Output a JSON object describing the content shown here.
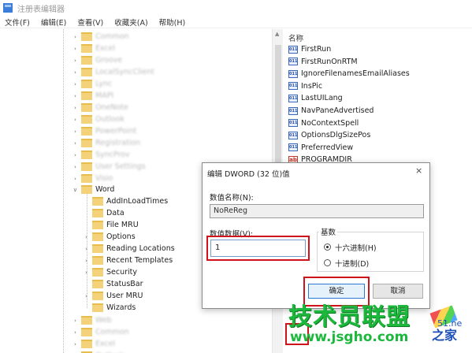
{
  "window": {
    "title": "注册表编辑器"
  },
  "menu": [
    "文件(F)",
    "编辑(E)",
    "查看(V)",
    "收藏夹(A)",
    "帮助(H)"
  ],
  "tree": {
    "blurred_above": [
      "Common",
      "Excel",
      "Groove",
      "LocalSyncClient",
      "Lync",
      "MAPI",
      "OneNote",
      "Outlook",
      "PowerPoint",
      "Registration",
      "SyncProv",
      "User Settings",
      "Visio"
    ],
    "word": {
      "label": "Word",
      "children": [
        "AddInLoadTimes",
        "Data",
        "File MRU",
        "Options",
        "Reading Locations",
        "Recent Templates",
        "Security",
        "StatusBar",
        "User MRU",
        "Wizards"
      ],
      "expandable": [
        "Options",
        "Reading Locations",
        "Recent Templates",
        "Security",
        "User MRU"
      ]
    },
    "blurred_below": [
      "Web",
      "Common",
      "Excel",
      "Outlook"
    ]
  },
  "values_pane": {
    "header": "名称",
    "items": [
      {
        "name": "FirstRun",
        "type": "dword"
      },
      {
        "name": "FirstRunOnRTM",
        "type": "dword"
      },
      {
        "name": "IgnoreFilenamesEmailAliases",
        "type": "dword"
      },
      {
        "name": "InsPic",
        "type": "dword"
      },
      {
        "name": "LastUILang",
        "type": "dword"
      },
      {
        "name": "NavPaneAdvertised",
        "type": "dword"
      },
      {
        "name": "NoContextSpell",
        "type": "dword"
      },
      {
        "name": "OptionsDlgSizePos",
        "type": "dword"
      },
      {
        "name": "PreferredView",
        "type": "dword"
      },
      {
        "name": "PROGRAMDIR",
        "type": "string"
      }
    ]
  },
  "dialog": {
    "title": "编辑 DWORD (32 位)值",
    "close_icon": "×",
    "name_label": "数值名称(N):",
    "name_value": "NoReReg",
    "data_label": "数值数据(V):",
    "data_value": "1",
    "base_label": "基数",
    "hex_label": "十六进制(H)",
    "dec_label": "十进制(D)",
    "selected_base": "hex",
    "ok_label": "确定",
    "cancel_label": "取消"
  },
  "watermark": {
    "line1": "技术员联盟",
    "line2": "www.jsgho.com",
    "side": "之家",
    "side_top": "51.ne"
  },
  "colors": {
    "highlight_red": "#d0121b",
    "watermark_green": "#1cb83c",
    "dialog_default_button": "#2f78d4"
  }
}
